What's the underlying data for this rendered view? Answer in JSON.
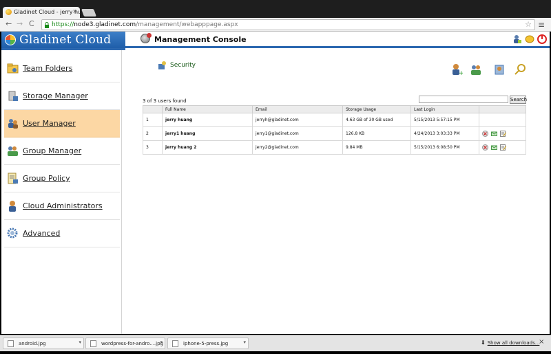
{
  "browser": {
    "tab_title": "Gladinet Cloud - jerry hua",
    "tab_close": "×",
    "url_https": "https://",
    "url_host": "node3.gladinet.com",
    "url_path": "/management/webapppage.aspx",
    "back_glyph": "←",
    "forward_glyph": "→",
    "reload_glyph": "C",
    "star_glyph": "☆",
    "menu_glyph": "≡"
  },
  "app": {
    "brand": "Gladinet Cloud",
    "console_title": "Management Console"
  },
  "sidebar": {
    "items": [
      {
        "label": "Team Folders",
        "icon": "team-folders-icon"
      },
      {
        "label": "Storage Manager",
        "icon": "storage-manager-icon"
      },
      {
        "label": "User Manager",
        "icon": "user-manager-icon",
        "active": true
      },
      {
        "label": "Group Manager",
        "icon": "group-manager-icon"
      },
      {
        "label": "Group Policy",
        "icon": "group-policy-icon"
      },
      {
        "label": "Cloud Administrators",
        "icon": "cloud-administrators-icon"
      },
      {
        "label": "Advanced",
        "icon": "advanced-gear-icon"
      }
    ]
  },
  "main": {
    "security_label": "Security",
    "found_text": "3 of 3 users found",
    "search_button": "Search",
    "search_value": "",
    "table": {
      "headers": [
        "",
        "Full Name",
        "Email",
        "Storage Usage",
        "Last Login",
        ""
      ],
      "rows": [
        {
          "num": "1",
          "name": "jerry huang",
          "email": "jerryh@gladinet.com",
          "usage": "4.63 GB of 30 GB used",
          "login": "5/15/2013 5:57:15 PM",
          "actions": false
        },
        {
          "num": "2",
          "name": "jerry1 huang",
          "email": "jerry1@gladinet.com",
          "usage": "126.8 KB",
          "login": "4/24/2013 3:03:33 PM",
          "actions": true
        },
        {
          "num": "3",
          "name": "jerry huang 2",
          "email": "jerry2@gladinet.com",
          "usage": "9.84 MB",
          "login": "5/15/2013 6:08:50 PM",
          "actions": true
        }
      ]
    }
  },
  "downloads": {
    "items": [
      "android.jpg",
      "wordpress-for-andro....jpg",
      "iphone-5-press.jpg"
    ],
    "show_all": "Show all downloads...",
    "close_glyph": "×",
    "dropdown_glyph": "▾"
  },
  "colors": {
    "brand_blue": "#2c68b0",
    "active_item": "#fcd7a4",
    "security_green": "#1a5a1a"
  }
}
